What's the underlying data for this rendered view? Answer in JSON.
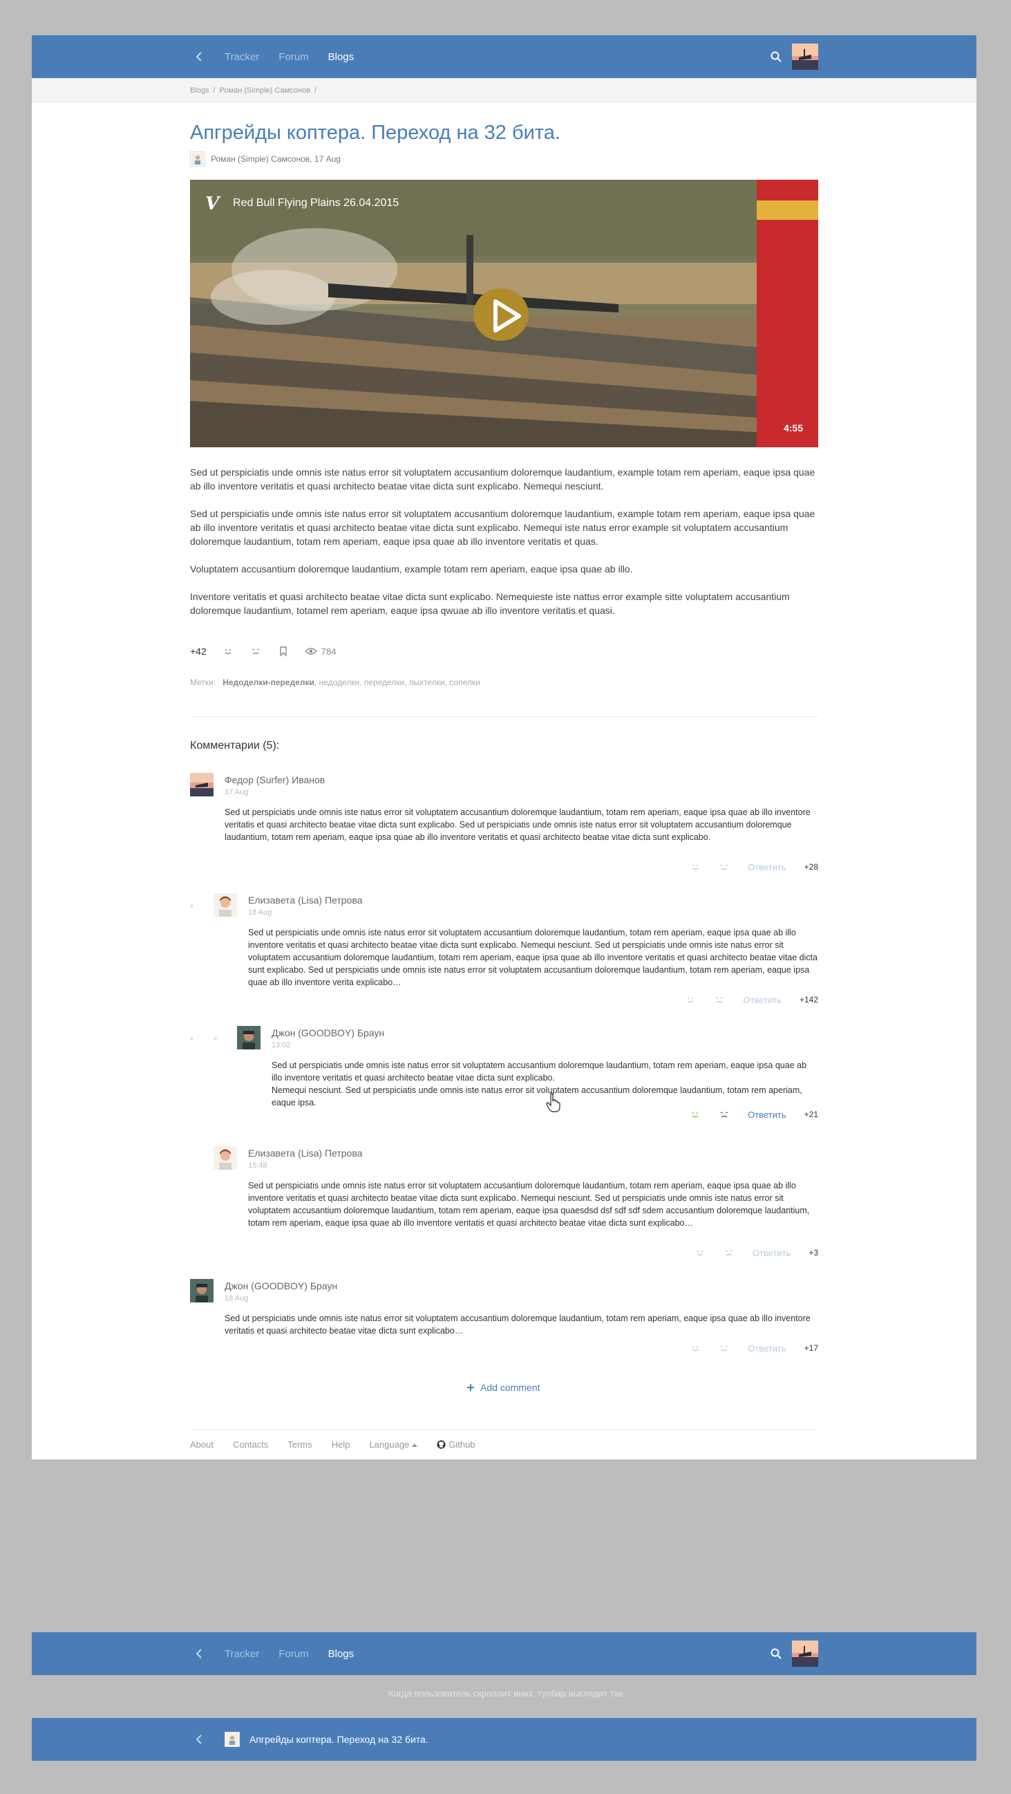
{
  "nav": {
    "tracker": "Tracker",
    "forum": "Forum",
    "blogs": "Blogs"
  },
  "breadcrumb": {
    "items": [
      "Blogs",
      "Роман (Simple) Самсонов"
    ],
    "separator": "/"
  },
  "post": {
    "title": "Апгрейды коптера. Переход на 32 бита.",
    "meta": "Роман (Simple) Самсонов, 17 Aug",
    "video": {
      "title": "Red Bull Flying Plains 26.04.2015",
      "logo": "V",
      "duration": "4:55"
    },
    "paragraphs": [
      "Sed ut perspiciatis unde omnis iste natus error sit voluptatem accusantium doloremque laudantium, example totam rem aperiam, eaque ipsa quae ab illo inventore veritatis et quasi architecto beatae vitae dicta sunt explicabo. Nemequi nesciunt.",
      "Sed ut perspiciatis unde omnis iste natus error sit voluptatem accusantium doloremque laudantium, example totam rem aperiam, eaque ipsa quae ab illo inventore veritatis et quasi architecto beatae vitae dicta sunt explicabo. Nemequi iste natus error example sit voluptatem accusantium doloremque laudantium,  totam rem aperiam, eaque ipsa quae ab illo inventore veritatis et quas.",
      "Voluptatem accusantium doloremque laudantium, example totam rem aperiam, eaque ipsa quae ab illo.",
      "Inventore veritatis et quasi architecto beatae vitae dicta sunt explicabo. Nemequieste iste nattus error example sitte voluptatem accusantium doloremque laudantium,  totamel rem aperiam, eaque ipsa qwuae ab illo inventore veritatis et quasi."
    ],
    "score": "+42",
    "views": "784",
    "tags_label": "Метки:",
    "tags_main": "Недоделки-переделки",
    "tags_rest": ", недоделки, переделки, пыхтелки, сопелки"
  },
  "comments_title": "Комментарии (5):",
  "comments": [
    {
      "author": "Федор (Surfer) Иванов",
      "date": "17 Aug",
      "text": "Sed ut perspiciatis unde omnis iste natus error sit voluptatem accusantium doloremque laudantium, totam rem aperiam, eaque ipsa quae ab illo inventore veritatis et quasi architecto beatae vitae dicta sunt explicabo. Sed ut perspiciatis unde omnis iste natus error sit voluptatem accusantium doloremque laudantium, totam rem aperiam, eaque ipsa quae ab illo inventore veritatis et quasi architecto beatae vitae dicta sunt explicabo.",
      "reply": "Ответить",
      "score": "+28"
    },
    {
      "author": "Елизавета (Lisa) Петрова",
      "date": "18 Aug",
      "text": "Sed ut perspiciatis unde omnis iste natus error sit voluptatem accusantium doloremque laudantium, totam rem aperiam, eaque ipsa quae ab illo inventore veritatis et quasi architecto beatae vitae dicta sunt explicabo. Nemequi nesciunt. Sed ut perspiciatis unde omnis iste natus error sit voluptatem accusantium doloremque laudantium, totam rem aperiam, eaque ipsa quae ab illo inventore veritatis et quasi architecto beatae vitae dicta sunt explicabo. Sed ut perspiciatis unde omnis iste natus error sit voluptatem accusantium doloremque laudantium, totam rem aperiam, eaque ipsa quae ab illo inventore verita explicabo…",
      "reply": "Ответить",
      "score": "+142"
    },
    {
      "author": "Джон (GOODBOY) Браун",
      "date": "13:02",
      "text": "Sed ut perspiciatis unde omnis iste natus error sit voluptatem accusantium doloremque laudantium, totam rem aperiam, eaque ipsa quae ab illo inventore veritatis et quasi architecto beatae vitae dicta sunt explicabo.",
      "text2": "Nemequi nesciunt. Sed ut perspiciatis unde omnis iste natus error sit voluptatem accusantium doloremque laudantium, totam rem aperiam, eaque ipsa.",
      "reply": "Ответить",
      "score": "+21"
    },
    {
      "author": "Елизавета (Lisa) Петрова",
      "date": "15:48",
      "text": "Sed ut perspiciatis unde omnis iste natus error sit voluptatem accusantium doloremque laudantium, totam rem aperiam, eaque ipsa quae ab illo inventore veritatis et quasi architecto beatae vitae dicta sunt explicabo. Nemequi nesciunt. Sed ut perspiciatis unde omnis iste natus error sit voluptatem accusantium doloremque laudantium, totam rem aperiam, eaque ipsa quaesdsd dsf sdf sdf sdem accusantium doloremque laudantium, totam rem aperiam, eaque ipsa quae ab illo inventore veritatis et quasi architecto beatae vitae dicta sunt explicabo…",
      "reply": "Ответить",
      "score": "+3"
    },
    {
      "author": "Джон (GOODBOY) Браун",
      "date": "18 Aug",
      "text": "Sed ut perspiciatis unde omnis iste natus error sit voluptatem accusantium doloremque laudantium, totam rem aperiam, eaque ipsa quae ab illo inventore veritatis et quasi architecto beatae vitae dicta sunt explicabo…",
      "reply": "Ответить",
      "score": "+17"
    }
  ],
  "add_comment": "Add comment",
  "footer": {
    "about": "About",
    "contacts": "Contacts",
    "terms": "Terms",
    "help": "Help",
    "language": "Language",
    "github": "Github"
  },
  "scroll_caption": "Когда пользователь скроллит вниз, тулбар выглядит так",
  "scrolled_title": "Апгрейды коптера. Переход на 32 бита.",
  "colors": {
    "brand": "#4a7db8",
    "reply_inactive": "#b9cbe0",
    "smile_active": "#6cc04a"
  }
}
